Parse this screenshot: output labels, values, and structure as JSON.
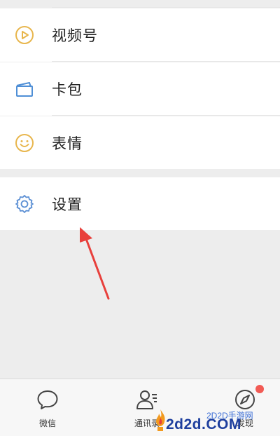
{
  "menu": {
    "items": [
      {
        "label": "视频号",
        "icon": "video-channel-icon",
        "color": "#e8b64d"
      },
      {
        "label": "卡包",
        "icon": "card-wallet-icon",
        "color": "#4f8fd6"
      },
      {
        "label": "表情",
        "icon": "smiley-icon",
        "color": "#e8b64d"
      },
      {
        "label": "设置",
        "icon": "gear-icon",
        "color": "#5b8fd4"
      }
    ]
  },
  "tabbar": {
    "tabs": [
      {
        "label": "微信",
        "icon": "chat-bubble-icon"
      },
      {
        "label": "通讯录",
        "icon": "contacts-icon"
      },
      {
        "label": "发现",
        "icon": "compass-icon",
        "badge": true
      }
    ]
  },
  "annotation": {
    "arrow_color": "#e8403c"
  },
  "watermark": {
    "top_text": "2D2D手游网",
    "main_text": "2d2d.COM"
  }
}
